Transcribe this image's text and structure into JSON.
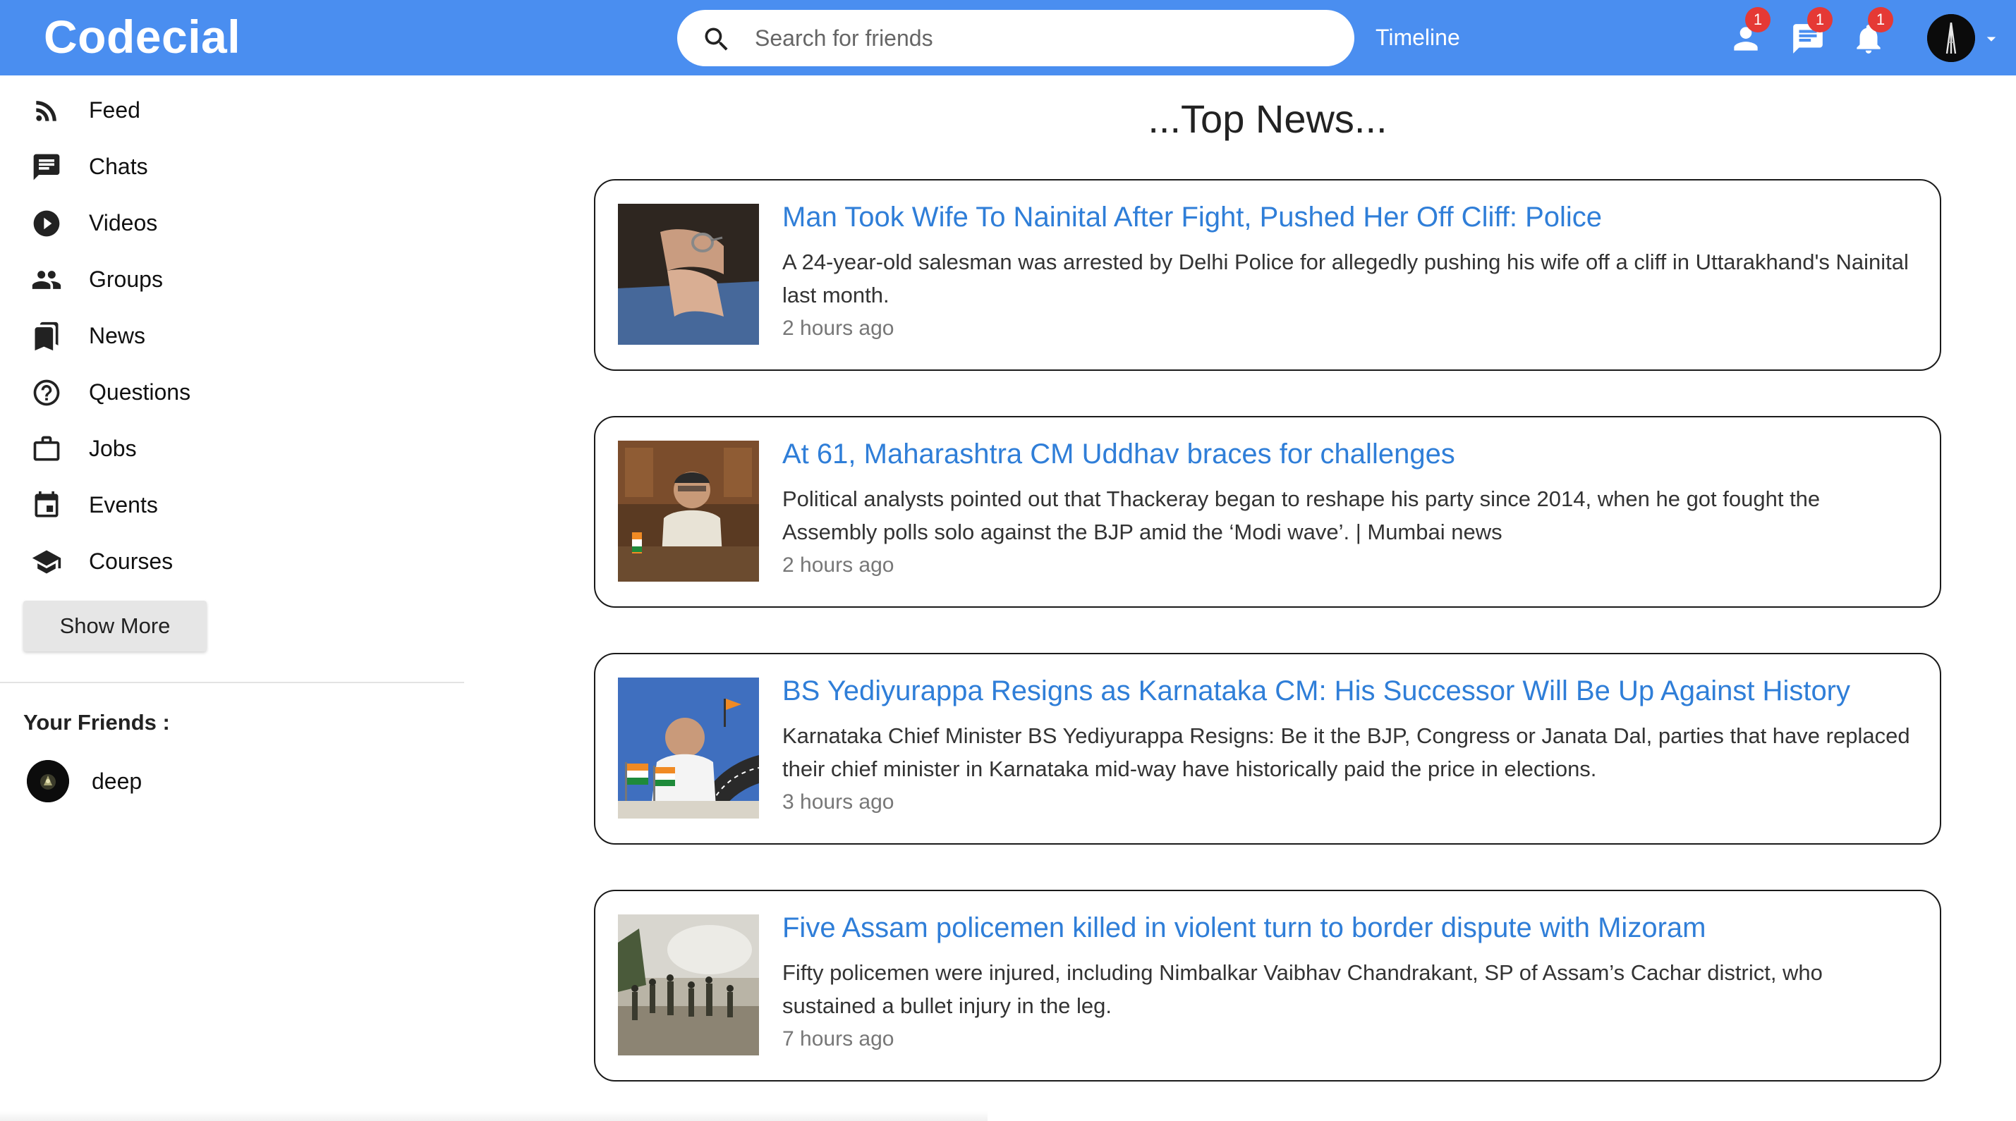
{
  "header": {
    "logo": "Codecial",
    "search_placeholder": "Search for friends",
    "timeline_label": "Timeline",
    "badges": {
      "friends": "1",
      "messages": "1",
      "notifications": "1"
    },
    "accent_color": "#4a8ef0"
  },
  "sidebar": {
    "items": [
      {
        "label": "Feed",
        "icon": "rss-icon"
      },
      {
        "label": "Chats",
        "icon": "chat-icon"
      },
      {
        "label": "Videos",
        "icon": "play-circle-icon"
      },
      {
        "label": "Groups",
        "icon": "group-icon"
      },
      {
        "label": "News",
        "icon": "bookmarks-icon"
      },
      {
        "label": "Questions",
        "icon": "help-circle-icon"
      },
      {
        "label": "Jobs",
        "icon": "briefcase-icon"
      },
      {
        "label": "Events",
        "icon": "calendar-icon"
      },
      {
        "label": "Courses",
        "icon": "school-icon"
      }
    ],
    "show_more": "Show More",
    "friends_title": "Your Friends :",
    "friends": [
      {
        "name": "deep"
      }
    ]
  },
  "main": {
    "title": "...Top News...",
    "news": [
      {
        "title": "Man Took Wife To Nainital After Fight, Pushed Her Off Cliff: Police",
        "desc": "A 24-year-old salesman was arrested by Delhi Police for allegedly pushing his wife off a cliff in Uttarakhand's Nainital last month.",
        "time": "2 hours ago"
      },
      {
        "title": "At 61, Maharashtra CM Uddhav braces for challenges",
        "desc": "Political analysts pointed out that Thackeray began to reshape his party since 2014, when he got fought the Assembly polls solo against the BJP amid the ‘Modi wave’. | Mumbai news",
        "time": "2 hours ago"
      },
      {
        "title": "BS Yediyurappa Resigns as Karnataka CM: His Successor Will Be Up Against History",
        "desc": "Karnataka Chief Minister BS Yediyurappa Resigns: Be it the BJP, Congress or Janata Dal, parties that have replaced their chief minister in Karnataka mid-way have historically paid the price in elections.",
        "time": "3 hours ago"
      },
      {
        "title": "Five Assam policemen killed in violent turn to border dispute with Mizoram",
        "desc": "Fifty policemen were injured, including Nimbalkar Vaibhav Chandrakant, SP of Assam’s Cachar district, who sustained a bullet injury in the leg.",
        "time": "7 hours ago"
      }
    ]
  }
}
